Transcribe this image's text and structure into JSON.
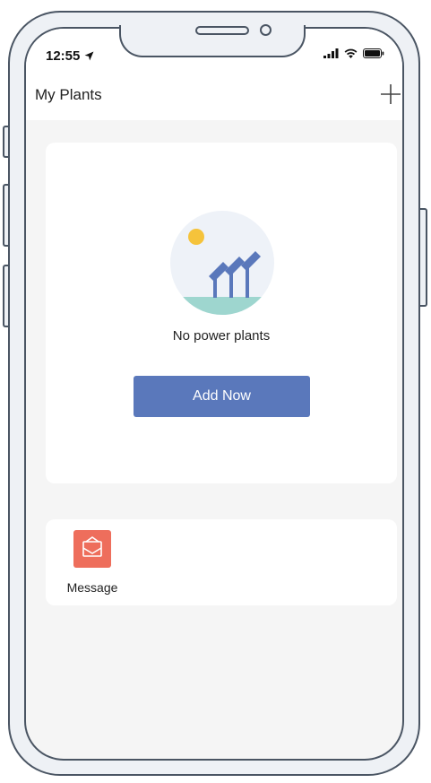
{
  "status_bar": {
    "time": "12:55"
  },
  "nav": {
    "title": "My Plants"
  },
  "empty_state": {
    "message": "No power plants",
    "button_label": "Add Now"
  },
  "shortcuts": {
    "items": [
      {
        "label": "Message",
        "icon": "envelope-icon"
      }
    ]
  },
  "colors": {
    "accent": "#5a78bb",
    "message_tile": "#ee6e5c",
    "background": "#f5f5f5",
    "ground": "#9ed6cf",
    "sun": "#f5c33b"
  }
}
